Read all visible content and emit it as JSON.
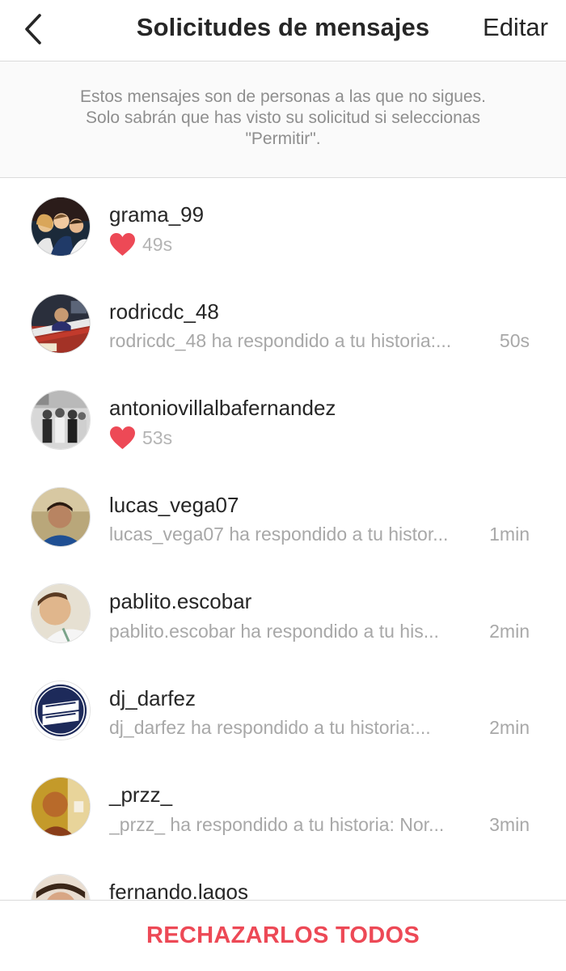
{
  "header": {
    "back_icon": "chevron-left-icon",
    "title": "Solicitudes de mensajes",
    "edit_label": "Editar"
  },
  "info": {
    "text": "Estos mensajes son de personas a las que no sigues.\nSolo sabrán que has visto su solicitud si seleccionas\n\"Permitir\"."
  },
  "colors": {
    "heart": "#ed4956",
    "reject_text": "#ed4956",
    "secondary_text": "#a8a8a8"
  },
  "requests": [
    {
      "username": "grama_99",
      "kind": "heart",
      "preview": "",
      "time": "49s"
    },
    {
      "username": "rodricdc_48",
      "kind": "text",
      "preview": "rodricdc_48 ha respondido a tu historia:...",
      "time": "50s"
    },
    {
      "username": "antoniovillalbafernandez",
      "kind": "heart",
      "preview": "",
      "time": "53s"
    },
    {
      "username": "lucas_vega07",
      "kind": "text",
      "preview": "lucas_vega07 ha respondido a tu histor...",
      "time": "1min"
    },
    {
      "username": "pablito.escobar",
      "kind": "text",
      "preview": "pablito.escobar ha respondido a tu his...",
      "time": "2min"
    },
    {
      "username": "dj_darfez",
      "kind": "text",
      "preview": "dj_darfez ha respondido a tu historia:...",
      "time": "2min"
    },
    {
      "username": "_przz_",
      "kind": "text",
      "preview": "_przz_ ha respondido a tu historia: Nor...",
      "time": "3min"
    },
    {
      "username": "fernando.lagos",
      "kind": "text",
      "preview": "",
      "time": ""
    }
  ],
  "footer": {
    "reject_all_label": "RECHAZARLOS TODOS"
  }
}
